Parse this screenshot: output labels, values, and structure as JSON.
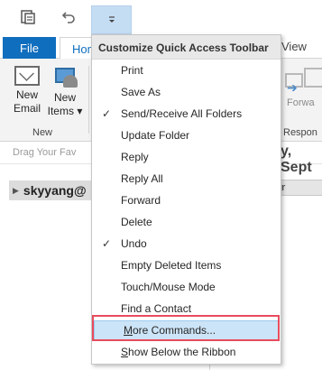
{
  "quick_access": {
    "send_receive_icon": "send-receive-icon",
    "undo_icon": "undo-icon",
    "customize_icon": "dropdown-arrow-icon"
  },
  "tabs": {
    "file": "File",
    "home": "Home",
    "view": "View"
  },
  "ribbon": {
    "new_email": [
      "New",
      "Email"
    ],
    "new_items": [
      "New",
      "Items ▾"
    ],
    "group_new": "New",
    "group_respond": "Respon",
    "forward_partial": "Forwa"
  },
  "below": {
    "drag_text": "Drag Your Fav",
    "date_partial": "y, Sept",
    "account": "skyyang@",
    "right_partial": "r"
  },
  "menu": {
    "header": "Customize Quick Access Toolbar",
    "items": [
      {
        "label": "Print",
        "checked": false
      },
      {
        "label": "Save As",
        "checked": false
      },
      {
        "label": "Send/Receive All Folders",
        "checked": true
      },
      {
        "label": "Update Folder",
        "checked": false
      },
      {
        "label": "Reply",
        "checked": false
      },
      {
        "label": "Reply All",
        "checked": false
      },
      {
        "label": "Forward",
        "checked": false
      },
      {
        "label": "Delete",
        "checked": false
      },
      {
        "label": "Undo",
        "checked": true
      },
      {
        "label": "Empty Deleted Items",
        "checked": false
      },
      {
        "label": "Touch/Mouse Mode",
        "checked": false
      },
      {
        "label": "Find a Contact",
        "checked": false
      },
      {
        "label": "More Commands...",
        "checked": false
      },
      {
        "label": "Show Below the Ribbon",
        "checked": false
      }
    ],
    "check_glyph": "✓"
  },
  "colors": {
    "file_tab": "#106ebe",
    "highlight": "#cce4f7",
    "annotation_frame": "#e84c5e"
  }
}
